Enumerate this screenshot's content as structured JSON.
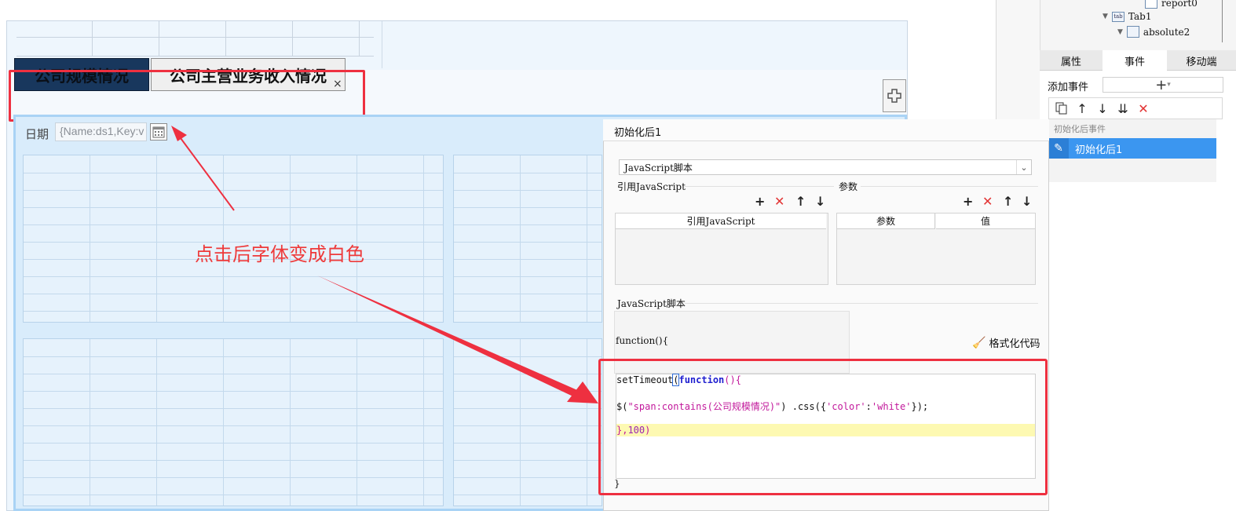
{
  "tabs": {
    "active_label": "公司规模情况",
    "second_label": "公司主营业务收入情况",
    "close_symbol": "×"
  },
  "filter": {
    "date_label": "日期",
    "date_value": "{Name:ds1,Key:v"
  },
  "annotation": {
    "note": "点击后字体变成白色"
  },
  "tree": {
    "items": [
      {
        "label": "report0"
      },
      {
        "label": "Tab1",
        "icon": "tab"
      },
      {
        "label": "absolute2"
      }
    ]
  },
  "right_tabs": [
    "属性",
    "事件",
    "移动端"
  ],
  "events": {
    "add_label": "添加事件",
    "add_symbol": "+",
    "group_label": "初始化后事件",
    "selected_item": "初始化后1"
  },
  "editor": {
    "title": "初始化后1",
    "type_select": "JavaScript脚本",
    "ref_js_label": "引用JavaScript",
    "params_label": "参数",
    "ref_js_header": "引用JavaScript",
    "param_header": "参数",
    "value_header": "值",
    "script_label": "JavaScript脚本",
    "fn_open": "function(){",
    "fn_close": "}",
    "format_label": "格式化代码",
    "code": {
      "line1_prefix": "setTimeout",
      "line1_paren": "(",
      "line1_kw": "function",
      "line1_suffix": "(){",
      "line2_prefix": "$(",
      "line2_str": "\"span:contains(公司规模情况)\"",
      "line2_mid": ") .css({",
      "line2_str2": "'color'",
      "line2_colon": ":",
      "line2_str3": "'white'",
      "line2_end": "});",
      "line3_prefix": "},",
      "line3_num": "100",
      "line3_end": ")"
    }
  },
  "colors": {
    "annotation_red": "#ee3040",
    "active_tab_bg": "#18375d",
    "selected_event_bg": "#3b96f0",
    "highlight_line": "#fdf9b2"
  }
}
